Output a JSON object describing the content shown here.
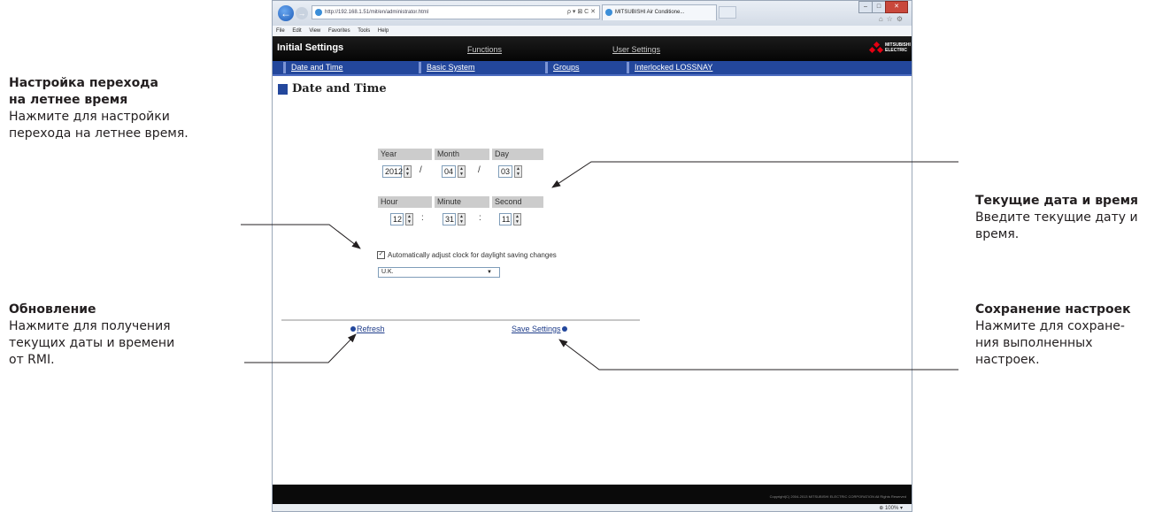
{
  "annotations": {
    "dst": {
      "title_line1": "Настройка перехода",
      "title_line2": "на летнее время",
      "body_line1": "Нажмите для настройки",
      "body_line2": "перехода на летнее время."
    },
    "refresh": {
      "title": "Обновление",
      "body_line1": "Нажмите для получения",
      "body_line2": "текущих даты и времени",
      "body_line3": "от RMI."
    },
    "current": {
      "title": "Текущие дата и время",
      "body_line1": "Введите текущие дату и",
      "body_line2": "время."
    },
    "save": {
      "title": "Сохранение настроек",
      "body_line1": "Нажмите для сохране-",
      "body_line2": "ния выполненных",
      "body_line3": "настроек."
    }
  },
  "browser": {
    "address": "http://192.168.1.51/mit/en/administrator.html",
    "address_tools": "ρ ▾ ⊠ C ✕",
    "tab_title": "MITSUBISHI Air Conditione...",
    "menu": [
      "File",
      "Edit",
      "View",
      "Favorites",
      "Tools",
      "Help"
    ],
    "zoom": "100%"
  },
  "page": {
    "title": "Initial Settings",
    "top_links": {
      "functions": "Functions",
      "user_settings": "User Settings"
    },
    "logo_text": "MITSUBISHI ELECTRIC",
    "subnav": [
      "Date and Time",
      "Basic System",
      "Groups",
      "Interlocked LOSSNAY"
    ],
    "section_title": "Date and Time",
    "date_labels": {
      "year": "Year",
      "month": "Month",
      "day": "Day"
    },
    "date_values": {
      "year": "2012",
      "month": "04",
      "day": "03"
    },
    "time_labels": {
      "hour": "Hour",
      "minute": "Minute",
      "second": "Second"
    },
    "time_values": {
      "hour": "12",
      "minute": "31",
      "second": "11"
    },
    "date_sep": "/",
    "time_sep": ":",
    "dst_checked": true,
    "dst_label": "Automatically adjust clock for daylight saving changes",
    "region": "U.K.",
    "refresh_label": "Refresh",
    "save_label": "Save Settings",
    "copyright": "Copyright(C) 2004-2013 MITSUBISHI ELECTRIC CORPORATION All Rights Reserved"
  }
}
